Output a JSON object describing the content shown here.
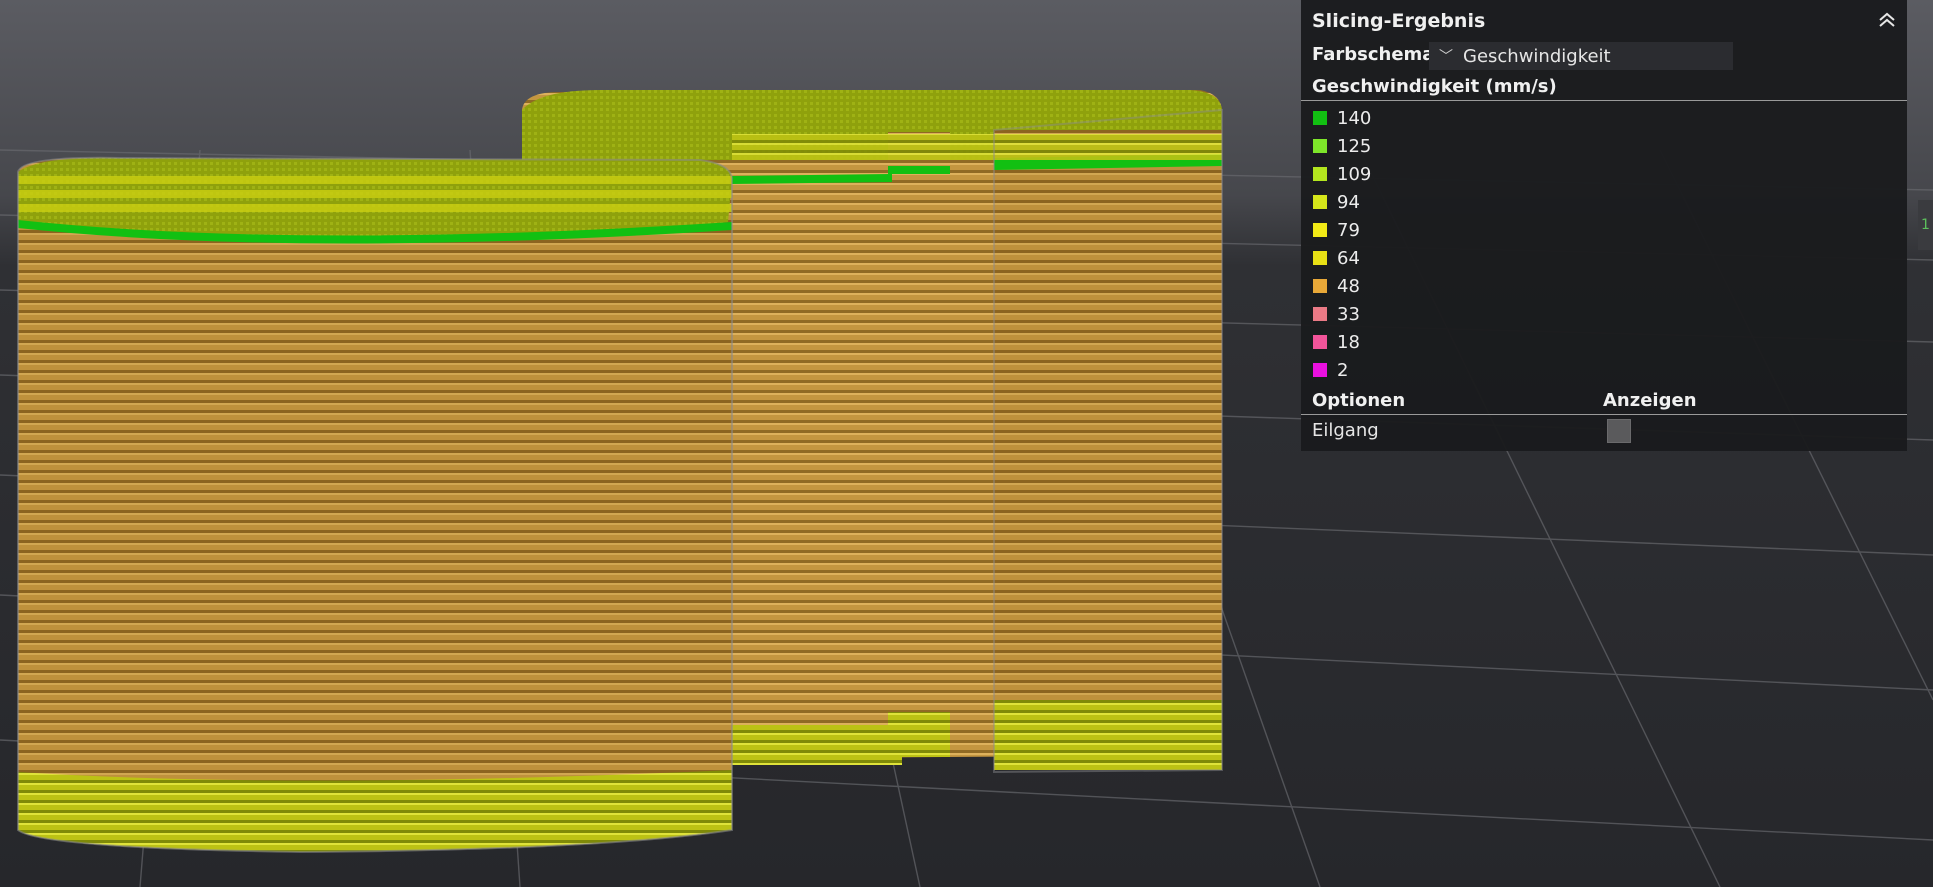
{
  "panel": {
    "title": "Slicing-Ergebnis",
    "color_scheme_label": "Farbschema",
    "color_scheme_value": "Geschwindigkeit",
    "legend_title": "Geschwindigkeit (mm/s)",
    "legend": [
      {
        "value": "140",
        "color": "#12c012"
      },
      {
        "value": "125",
        "color": "#7ee62a"
      },
      {
        "value": "109",
        "color": "#b3e61e"
      },
      {
        "value": "94",
        "color": "#d6e61a"
      },
      {
        "value": "79",
        "color": "#f2ea16"
      },
      {
        "value": "64",
        "color": "#e8e015"
      },
      {
        "value": "48",
        "color": "#e8a838"
      },
      {
        "value": "33",
        "color": "#ea7a86"
      },
      {
        "value": "18",
        "color": "#f2549a"
      },
      {
        "value": "2",
        "color": "#ea10e0"
      }
    ],
    "options_header": "Optionen",
    "show_header": "Anzeigen",
    "options": [
      {
        "label": "Eilgang",
        "checked": false
      }
    ]
  },
  "edge_tab_text": "1",
  "colors": {
    "background": "#2d2e32",
    "panel": "#1a1b1d",
    "print_body": "#b98d3a",
    "print_top": "#9aa80a",
    "perimeter_fast": "#12c012",
    "perimeter_medium": "#c8cc12"
  }
}
